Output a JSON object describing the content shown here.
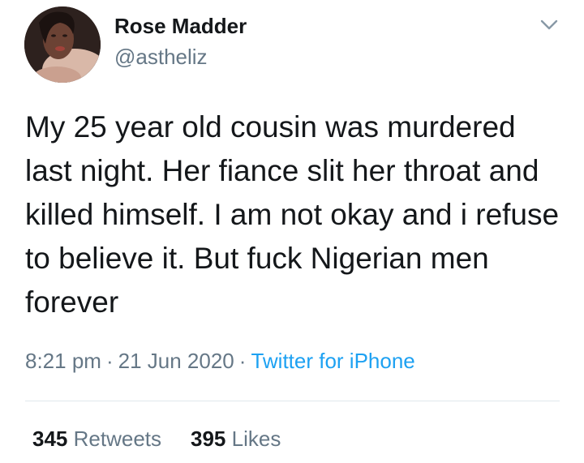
{
  "user": {
    "name": "Rose Madder",
    "handle": "@astheliz"
  },
  "tweet": {
    "text": "My 25 year old cousin was murdered last night. Her fiance slit her throat and killed himself. I am not okay and i refuse to believe it. But fuck Nigerian men forever",
    "time": "8:21 pm",
    "separator": "·",
    "date": "21 Jun 2020",
    "source": "Twitter for iPhone"
  },
  "stats": {
    "retweets_count": "345",
    "retweets_label": "Retweets",
    "likes_count": "395",
    "likes_label": "Likes"
  },
  "colors": {
    "text": "#14171a",
    "secondary": "#657786",
    "link": "#1da1f2",
    "divider": "#e1e8ed"
  },
  "icons": {
    "menu": "chevron-down-icon"
  }
}
